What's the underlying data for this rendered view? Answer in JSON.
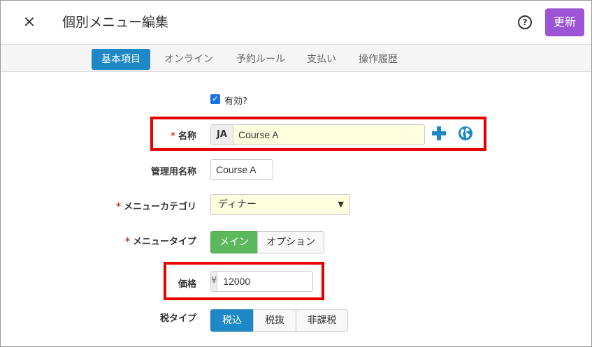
{
  "header": {
    "close_label": "×",
    "title": "個別メニュー編集",
    "help_label": "?",
    "update_label": "更新"
  },
  "tabs": [
    {
      "label": "基本項目",
      "active": true
    },
    {
      "label": "オンライン",
      "active": false
    },
    {
      "label": "予約ルール",
      "active": false
    },
    {
      "label": "支払い",
      "active": false
    },
    {
      "label": "操作履歴",
      "active": false
    }
  ],
  "form": {
    "enabled": {
      "label": "有効?",
      "checked": true
    },
    "required_mark": "*",
    "name": {
      "label": "名称",
      "lang": "JA",
      "value": "Course A"
    },
    "admin_name": {
      "label": "管理用名称",
      "value": "Course A"
    },
    "category": {
      "label": "メニューカテゴリ",
      "value": "ディナー"
    },
    "menu_type": {
      "label": "メニュータイプ",
      "options": [
        "メイン",
        "オプション"
      ],
      "selected": "メイン"
    },
    "price": {
      "label": "価格",
      "currency": "¥",
      "value": "12000"
    },
    "tax_type": {
      "label": "税タイプ",
      "options": [
        "税込",
        "税抜",
        "非課税"
      ],
      "selected": "税込"
    }
  },
  "colors": {
    "accent_blue": "#1e88c7",
    "update_purple": "#9b55d6",
    "selected_green": "#5cb85c",
    "highlight_red": "#e60000",
    "input_yellow": "#ffffe0"
  }
}
